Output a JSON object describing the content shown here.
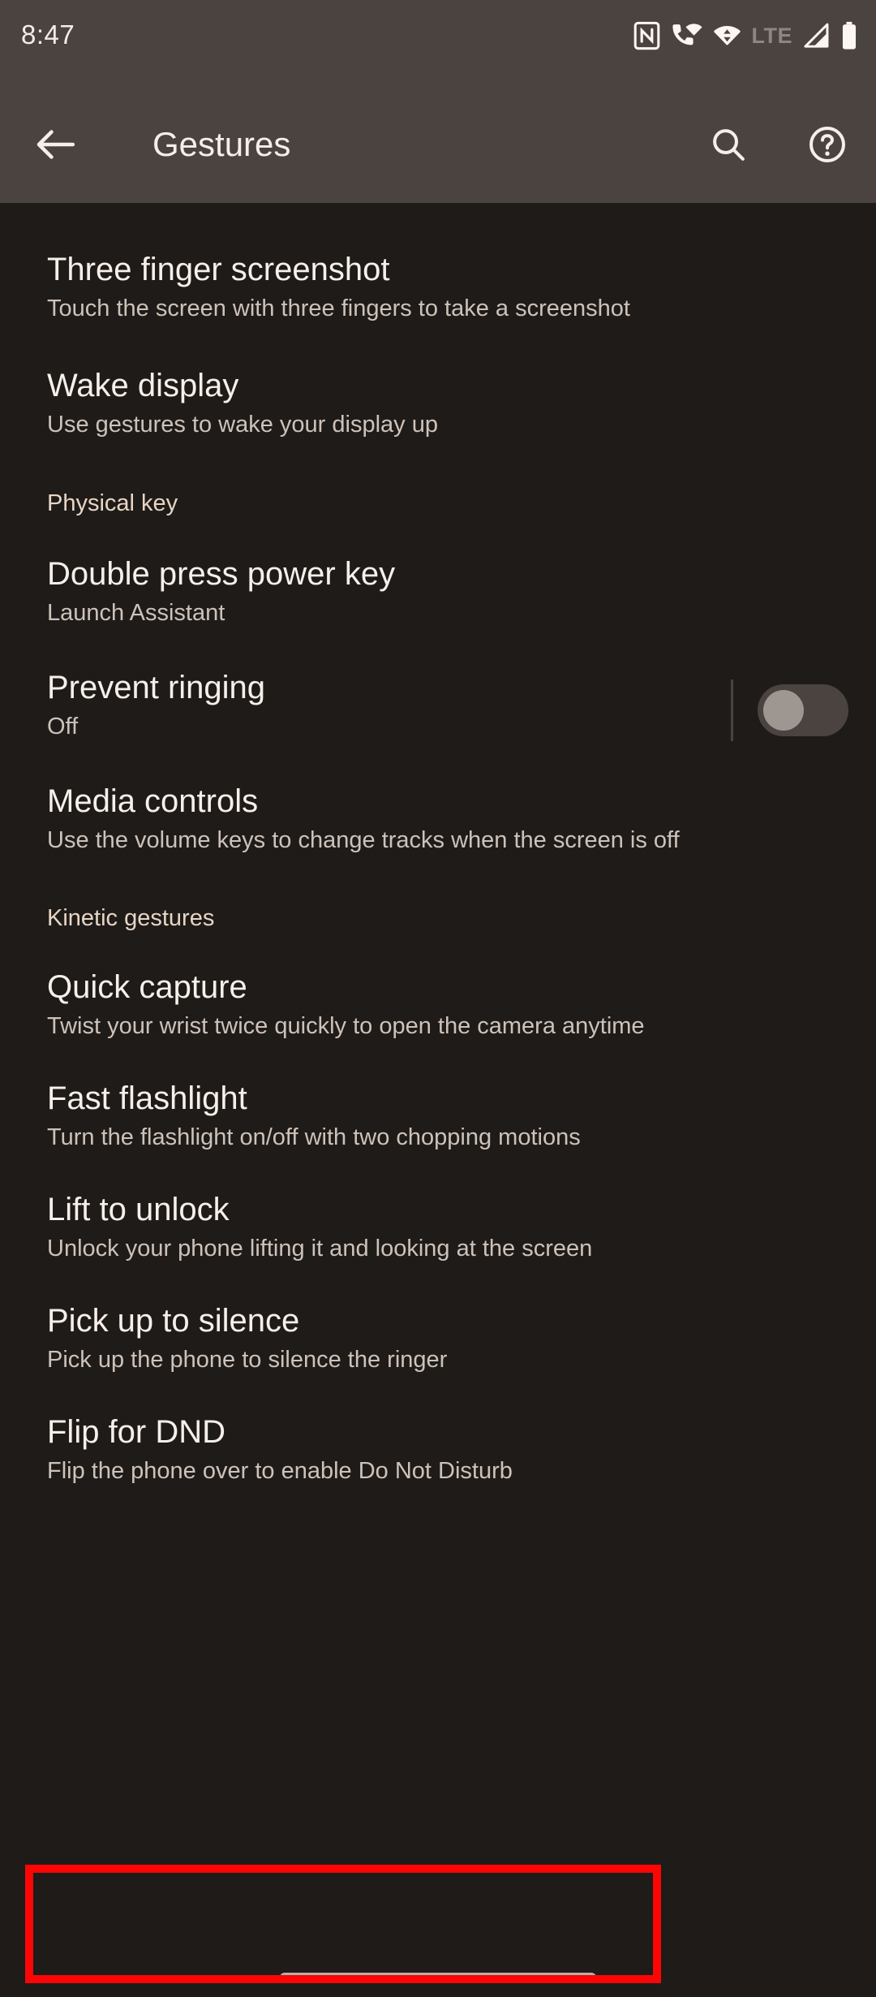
{
  "status_bar": {
    "time": "8:47",
    "icons": [
      {
        "name": "nfc-icon",
        "label": "NFC"
      },
      {
        "name": "vowifi-icon",
        "label": "VoWiFi calling"
      },
      {
        "name": "wifi-transfer-icon",
        "label": "Wi-Fi"
      },
      {
        "name": "lte-icon",
        "label": "LTE"
      },
      {
        "name": "cellular-signal-icon",
        "label": "Signal"
      },
      {
        "name": "battery-icon",
        "label": "Battery"
      }
    ]
  },
  "app_bar": {
    "back_label": "Back",
    "title": "Gestures",
    "search_label": "Search",
    "help_label": "Help"
  },
  "list": [
    {
      "kind": "item",
      "name": "three-finger-screenshot",
      "title": "Three finger screenshot",
      "summary": "Touch the screen with three fingers to take a screenshot"
    },
    {
      "kind": "item",
      "name": "wake-display",
      "title": "Wake display",
      "summary": "Use gestures to wake your display up"
    },
    {
      "kind": "header",
      "name": "physical-key",
      "title": "Physical key"
    },
    {
      "kind": "item",
      "name": "double-press-power-key",
      "title": "Double press power key",
      "summary": "Launch Assistant"
    },
    {
      "kind": "toggle",
      "name": "prevent-ringing",
      "title": "Prevent ringing",
      "summary": "Off",
      "checked": false
    },
    {
      "kind": "item",
      "name": "media-controls",
      "title": "Media controls",
      "summary": "Use the volume keys to change tracks when the screen is off"
    },
    {
      "kind": "header",
      "name": "kinetic-gestures",
      "title": "Kinetic gestures"
    },
    {
      "kind": "item",
      "name": "quick-capture",
      "title": "Quick capture",
      "summary": "Twist your wrist twice quickly to open the camera anytime"
    },
    {
      "kind": "item",
      "name": "fast-flashlight",
      "title": "Fast flashlight",
      "summary": "Turn the flashlight on/off with two chopping motions"
    },
    {
      "kind": "item",
      "name": "lift-to-unlock",
      "title": "Lift to unlock",
      "summary": "Unlock your phone lifting it and looking at the screen"
    },
    {
      "kind": "item",
      "name": "pick-up-to-silence",
      "title": "Pick up to silence",
      "summary": "Pick up the phone to silence the ringer"
    },
    {
      "kind": "item",
      "name": "flip-for-dnd",
      "title": "Flip for DND",
      "summary": "Flip the phone over to enable Do Not Disturb",
      "highlighted": true
    }
  ],
  "annotation": {
    "name": "highlight-box",
    "color": "#fb0505",
    "target": "flip-for-dnd"
  },
  "colors": {
    "app_bar_bg": "#4b4340",
    "content_bg": "#1e1b19",
    "title_text": "#f7efe9",
    "summary_text": "#cdc2b9",
    "section_header_text": "#e8d5c4",
    "switch_track_off": "#4b4340",
    "switch_thumb_off": "#9e9691",
    "nav_pill": "#b6b0ab"
  }
}
